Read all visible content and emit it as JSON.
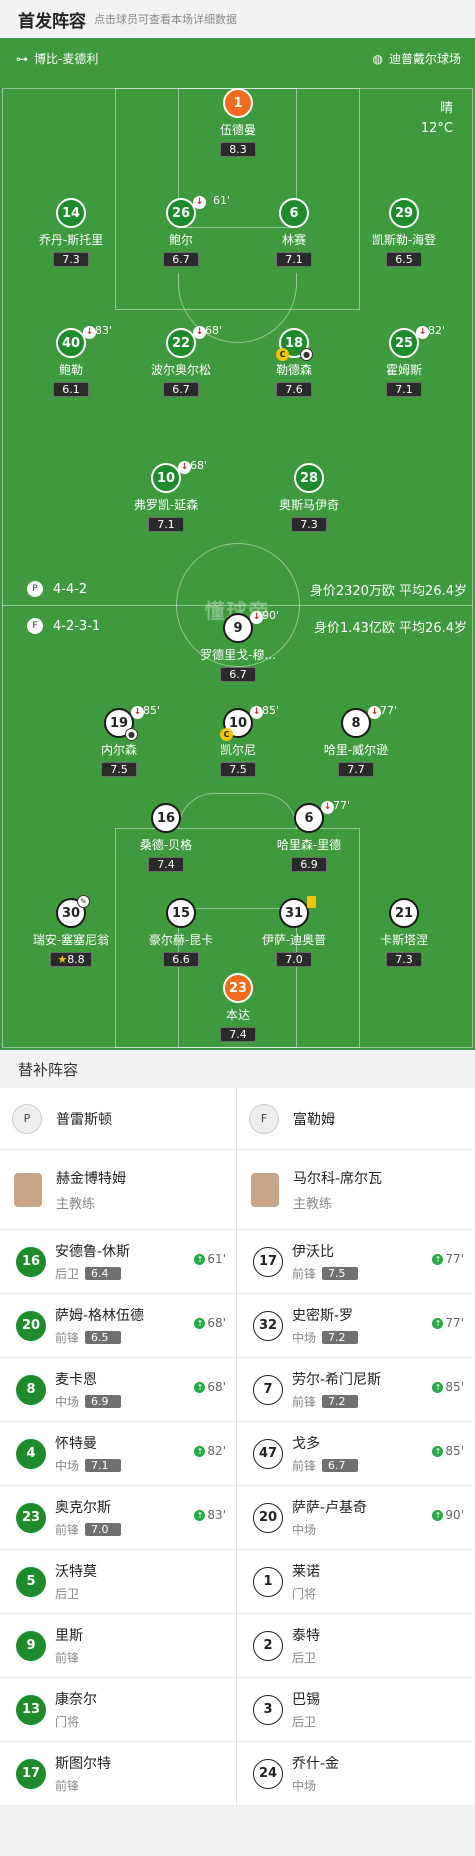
{
  "header": {
    "title": "首发阵容",
    "subtitle": "点击球员可查看本场详细数据"
  },
  "pitch": {
    "referee": "博比-麦德利",
    "stadium": "迪普戴尔球场",
    "weather": "晴",
    "temperature": "12°C",
    "watermark": "懂球帝",
    "home_team": {
      "formation": "4-4-2",
      "value": "身价2320万欧  平均26.4岁"
    },
    "away_team": {
      "formation": "4-2-3-1",
      "value": "身价1.43亿欧  平均26.4岁"
    }
  },
  "home_players": [
    {
      "num": "1",
      "name": "伍德曼",
      "rating": "8.3"
    },
    {
      "num": "14",
      "name": "乔丹-斯托里",
      "rating": "7.3"
    },
    {
      "num": "26",
      "name": "鲍尔",
      "rating": "6.7",
      "sub": "61'"
    },
    {
      "num": "6",
      "name": "林赛",
      "rating": "7.1"
    },
    {
      "num": "29",
      "name": "凯斯勒-海登",
      "rating": "6.5"
    },
    {
      "num": "40",
      "name": "鲍勒",
      "rating": "6.1",
      "sub": "83'"
    },
    {
      "num": "22",
      "name": "波尔奥尔松",
      "rating": "6.7",
      "sub": "68'"
    },
    {
      "num": "18",
      "name": "勒德森",
      "rating": "7.6"
    },
    {
      "num": "25",
      "name": "霍姆斯",
      "rating": "7.1",
      "sub": "82'"
    },
    {
      "num": "10",
      "name": "弗罗凯-延森",
      "rating": "7.1",
      "sub": "68'"
    },
    {
      "num": "28",
      "name": "奥斯马伊奇",
      "rating": "7.3"
    }
  ],
  "away_players": [
    {
      "num": "9",
      "name": "罗德里戈-穆...",
      "rating": "6.7",
      "sub": "90'"
    },
    {
      "num": "19",
      "name": "内尔森",
      "rating": "7.5",
      "sub": "85'"
    },
    {
      "num": "10",
      "name": "凯尔尼",
      "rating": "7.5",
      "sub": "85'"
    },
    {
      "num": "8",
      "name": "哈里-威尔逊",
      "rating": "7.7",
      "sub": "77'"
    },
    {
      "num": "16",
      "name": "桑德-贝格",
      "rating": "7.4"
    },
    {
      "num": "6",
      "name": "哈里森-里德",
      "rating": "6.9",
      "sub": "77'"
    },
    {
      "num": "30",
      "name": "瑞安-塞塞尼翁",
      "rating": "8.8"
    },
    {
      "num": "15",
      "name": "豪尔赫-昆卡",
      "rating": "6.6"
    },
    {
      "num": "31",
      "name": "伊萨-迪奥普",
      "rating": "7.0"
    },
    {
      "num": "21",
      "name": "卡斯塔涅",
      "rating": "7.3"
    },
    {
      "num": "23",
      "name": "本达",
      "rating": "7.4"
    }
  ],
  "substitutes": {
    "title": "替补阵容",
    "home": {
      "team": "普雷斯顿",
      "coach": {
        "name": "赫金博特姆",
        "role": "主教练"
      },
      "players": [
        {
          "num": "16",
          "name": "安德鲁-休斯",
          "pos": "后卫",
          "rating": "6.4",
          "in": "61'"
        },
        {
          "num": "20",
          "name": "萨姆-格林伍德",
          "pos": "前锋",
          "rating": "6.5",
          "in": "68'"
        },
        {
          "num": "8",
          "name": "麦卡恩",
          "pos": "中场",
          "rating": "6.9",
          "in": "68'"
        },
        {
          "num": "4",
          "name": "怀特曼",
          "pos": "中场",
          "rating": "7.1",
          "in": "82'"
        },
        {
          "num": "23",
          "name": "奥克尔斯",
          "pos": "前锋",
          "rating": "7.0",
          "in": "83'"
        },
        {
          "num": "5",
          "name": "沃特莫",
          "pos": "后卫"
        },
        {
          "num": "9",
          "name": "里斯",
          "pos": "前锋"
        },
        {
          "num": "13",
          "name": "康奈尔",
          "pos": "门将"
        },
        {
          "num": "17",
          "name": "斯图尔特",
          "pos": "前锋"
        }
      ]
    },
    "away": {
      "team": "富勒姆",
      "coach": {
        "name": "马尔科-席尔瓦",
        "role": "主教练"
      },
      "players": [
        {
          "num": "17",
          "name": "伊沃比",
          "pos": "前锋",
          "rating": "7.5",
          "in": "77'"
        },
        {
          "num": "32",
          "name": "史密斯-罗",
          "pos": "中场",
          "rating": "7.2",
          "in": "77'"
        },
        {
          "num": "7",
          "name": "劳尔-希门尼斯",
          "pos": "前锋",
          "rating": "7.2",
          "in": "85'"
        },
        {
          "num": "47",
          "name": "戈多",
          "pos": "前锋",
          "rating": "6.7",
          "in": "85'"
        },
        {
          "num": "20",
          "name": "萨萨-卢基奇",
          "pos": "中场",
          "in": "90'"
        },
        {
          "num": "1",
          "name": "莱诺",
          "pos": "门将"
        },
        {
          "num": "2",
          "name": "泰特",
          "pos": "后卫"
        },
        {
          "num": "3",
          "name": "巴锡",
          "pos": "后卫"
        },
        {
          "num": "24",
          "name": "乔什-金",
          "pos": "中场"
        }
      ]
    }
  }
}
